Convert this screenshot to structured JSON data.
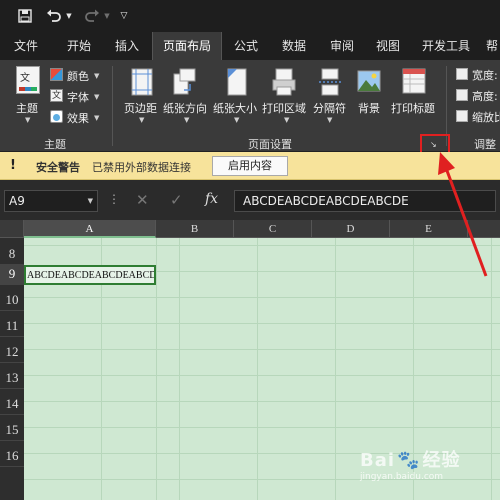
{
  "quick_access": [
    "save-icon",
    "undo-icon",
    "redo-icon",
    "customize-icon"
  ],
  "tabs": [
    "文件",
    "开始",
    "插入",
    "页面布局",
    "公式",
    "数据",
    "审阅",
    "视图",
    "开发工具",
    "帮"
  ],
  "active_tab": "页面布局",
  "ribbon": {
    "theme_group": {
      "theme_label": "主题",
      "colors_label": "颜色",
      "fonts_label": "字体",
      "effects_label": "效果",
      "group_label": "主题"
    },
    "page_setup_group": {
      "margins_label": "页边距",
      "orientation_label": "纸张方向",
      "size_label": "纸张大小",
      "print_area_label": "打印区域",
      "breaks_label": "分隔符",
      "background_label": "背景",
      "print_titles_label": "打印标题",
      "group_label": "页面设置"
    },
    "scale_group": {
      "width_label": "宽度:",
      "height_label": "高度:",
      "scale_label": "缩放比",
      "group_label": "调整"
    }
  },
  "security_bar": {
    "title": "安全警告",
    "message": "已禁用外部数据连接",
    "enable_button": "启用内容"
  },
  "formula_bar": {
    "name_box": "A9",
    "formula": "ABCDEABCDEABCDEABCDE"
  },
  "columns": [
    "A",
    "B",
    "C",
    "D",
    "E"
  ],
  "rows": [
    "8",
    "9",
    "10",
    "11",
    "12",
    "13",
    "14",
    "15",
    "16"
  ],
  "cell_a9": "ABCDEABCDEABCDEABCDE",
  "watermark": {
    "brand": "Bai",
    "brand2": "经验",
    "url": "jingyan.baidu.com"
  },
  "colors": {
    "highlight": "#e02020",
    "grid_bg": "#cfe8d2",
    "security_bar": "#f7e39b"
  }
}
